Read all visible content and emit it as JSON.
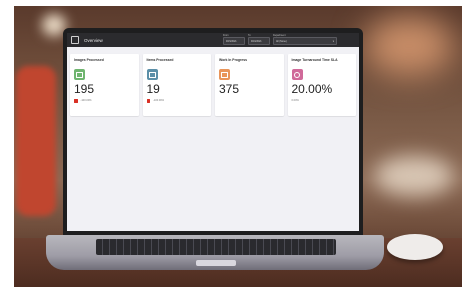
{
  "app": {
    "title": "Overview"
  },
  "filters": {
    "from_label": "From",
    "to_label": "To",
    "from_value": "9/15/2021",
    "to_value": "9/16/2021",
    "dept_label": "Department",
    "dept_value": "All (None)"
  },
  "cards": [
    {
      "title": "Images Processed",
      "value": "195",
      "delta": "-100.00%",
      "icon": "images-icon",
      "icon_color": "#6fb56f"
    },
    {
      "title": "Items Processed",
      "value": "19",
      "delta": "-100.00%",
      "icon": "folder-icon",
      "icon_color": "#5b8fa8"
    },
    {
      "title": "Work In Progress",
      "value": "375",
      "delta": "",
      "icon": "briefcase-icon",
      "icon_color": "#e9955a"
    },
    {
      "title": "Image Turnaround Time SLA",
      "value": "20.00%",
      "delta": "0.00%",
      "icon": "clock-icon",
      "icon_color": "#d06a9a"
    }
  ],
  "colors": {
    "delta_negative": "#d93025",
    "topbar": "#2b2b2e"
  }
}
